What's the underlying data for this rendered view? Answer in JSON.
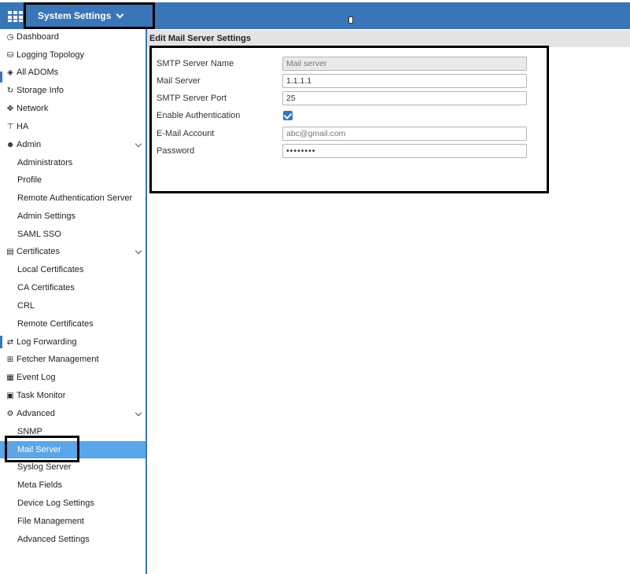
{
  "app": {
    "title": "System Settings",
    "accent_color": "#3a75b7",
    "grid_icon": "grid-icon",
    "dropdown_icon": "chevron-down-icon"
  },
  "sidebar": {
    "items": [
      {
        "label": "Dashboard",
        "icon": "dashboard-icon",
        "level": "top"
      },
      {
        "label": "Logging Topology",
        "icon": "topology-icon",
        "level": "top"
      },
      {
        "label": "All ADOMs",
        "icon": "globe-icon",
        "level": "top"
      },
      {
        "label": "Storage Info",
        "icon": "storage-icon",
        "level": "top"
      },
      {
        "label": "Network",
        "icon": "network-icon",
        "level": "top"
      },
      {
        "label": "HA",
        "icon": "ha-icon",
        "level": "top"
      },
      {
        "label": "Admin",
        "icon": "user-icon",
        "level": "top",
        "expandable": true
      },
      {
        "label": "Administrators",
        "level": "sub"
      },
      {
        "label": "Profile",
        "level": "sub"
      },
      {
        "label": "Remote Authentication Server",
        "level": "sub"
      },
      {
        "label": "Admin Settings",
        "level": "sub"
      },
      {
        "label": "SAML SSO",
        "level": "sub"
      },
      {
        "label": "Certificates",
        "icon": "certificate-icon",
        "level": "top",
        "expandable": true
      },
      {
        "label": "Local Certificates",
        "level": "sub"
      },
      {
        "label": "CA Certificates",
        "level": "sub"
      },
      {
        "label": "CRL",
        "level": "sub"
      },
      {
        "label": "Remote Certificates",
        "level": "sub"
      },
      {
        "label": "Log Forwarding",
        "icon": "forward-icon",
        "level": "top"
      },
      {
        "label": "Fetcher Management",
        "icon": "fetcher-icon",
        "level": "top"
      },
      {
        "label": "Event Log",
        "icon": "event-log-icon",
        "level": "top"
      },
      {
        "label": "Task Monitor",
        "icon": "task-monitor-icon",
        "level": "top"
      },
      {
        "label": "Advanced",
        "icon": "advanced-icon",
        "level": "top",
        "expandable": true
      },
      {
        "label": "SNMP",
        "level": "sub"
      },
      {
        "label": "Mail Server",
        "level": "sub",
        "active": true
      },
      {
        "label": "Syslog Server",
        "level": "sub"
      },
      {
        "label": "Meta Fields",
        "level": "sub"
      },
      {
        "label": "Device Log Settings",
        "level": "sub"
      },
      {
        "label": "File Management",
        "level": "sub"
      },
      {
        "label": "Advanced Settings",
        "level": "sub"
      }
    ],
    "active_color": "#5aa6e8"
  },
  "main": {
    "header": "Edit Mail Server Settings",
    "form": {
      "smtp_server_name": {
        "label": "SMTP Server Name",
        "placeholder": "Mail server"
      },
      "mail_server": {
        "label": "Mail Server",
        "value": "1.1.1.1"
      },
      "smtp_server_port": {
        "label": "SMTP Server Port",
        "value": "25"
      },
      "enable_authentication": {
        "label": "Enable Authentication",
        "checked": true
      },
      "email_account": {
        "label": "E-Mail Account",
        "placeholder": "abc@gmail.com"
      },
      "password": {
        "label": "Password",
        "value": "••••••••"
      }
    }
  }
}
